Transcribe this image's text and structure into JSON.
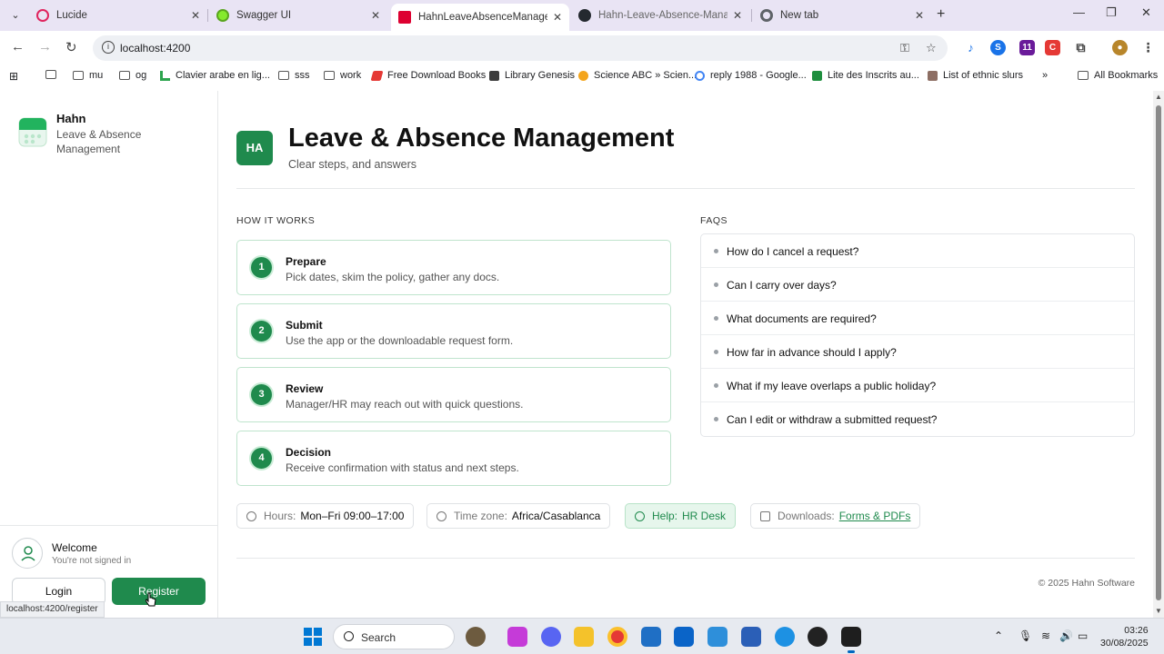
{
  "browser": {
    "tabs": [
      {
        "title": "Lucide",
        "color": "#e0245e"
      },
      {
        "title": "Swagger UI",
        "color": "#85ea2d"
      },
      {
        "title": "HahnLeaveAbsenceManageme",
        "color": "#dd0031"
      },
      {
        "title": "Hahn-Leave-Absence-Manage",
        "color": "#24292f"
      },
      {
        "title": "New tab",
        "color": "#5f6368"
      }
    ],
    "address": "localhost:4200",
    "bookmarks": [
      "mu",
      "og",
      "Clavier arabe en lig...",
      "sss",
      "work",
      "Free Download Books",
      "Library Genesis",
      "Science ABC » Scien...",
      "reply 1988 - Google...",
      "Lite des Inscrits au...",
      "List of ethnic slurs",
      "All Bookmarks"
    ],
    "status_url": "localhost:4200/register"
  },
  "sidebar": {
    "brand_name": "Hahn",
    "brand_sub": "Leave & Absence Management",
    "welcome_title": "Welcome",
    "welcome_sub": "You're not signed in",
    "login_label": "Login",
    "register_label": "Register"
  },
  "header": {
    "badge": "HA",
    "title": "Leave & Absence Management",
    "subtitle": "Clear steps, and answers"
  },
  "how_it_works": {
    "label": "HOW IT WORKS",
    "steps": [
      {
        "num": "1",
        "title": "Prepare",
        "desc": "Pick dates, skim the policy, gather any docs."
      },
      {
        "num": "2",
        "title": "Submit",
        "desc": "Use the app or the downloadable request form."
      },
      {
        "num": "3",
        "title": "Review",
        "desc": "Manager/HR may reach out with quick questions."
      },
      {
        "num": "4",
        "title": "Decision",
        "desc": "Receive confirmation with status and next steps."
      }
    ]
  },
  "faqs": {
    "label": "FAQS",
    "items": [
      "How do I cancel a request?",
      "Can I carry over days?",
      "What documents are required?",
      "How far in advance should I apply?",
      "What if my leave overlaps a public holiday?",
      "Can I edit or withdraw a submitted request?"
    ]
  },
  "info": {
    "hours_label": "Hours:",
    "hours_value": "Mon–Fri 09:00–17:00",
    "tz_label": "Time zone:",
    "tz_value": "Africa/Casablanca",
    "help_label": "Help:",
    "help_value": "HR Desk",
    "dl_label": "Downloads:",
    "dl_value": "Forms & PDFs"
  },
  "footer": "© 2025 Hahn Software",
  "taskbar": {
    "search": "Search",
    "time": "03:26",
    "date": "30/08/2025"
  },
  "colors": {
    "accent": "#1f8a4d",
    "accent_light": "#e6f6ec"
  }
}
